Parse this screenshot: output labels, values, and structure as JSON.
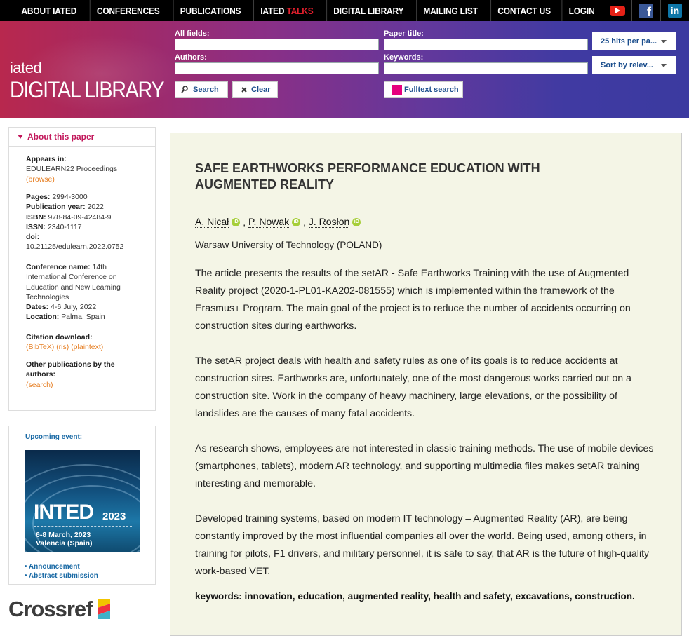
{
  "nav": {
    "items": [
      "ABOUT IATED",
      "CONFERENCES",
      "PUBLICATIONS",
      "IATED",
      "DIGITAL LIBRARY",
      "MAILING LIST",
      "CONTACT US",
      "LOGIN"
    ],
    "talks_suffix": "TALKS",
    "social_icons": [
      "youtube-icon",
      "facebook-icon",
      "linkedin-icon"
    ],
    "fb_glyph": "f",
    "li_glyph": "in"
  },
  "brand": {
    "small": "iated",
    "big": "DIGITAL LIBRARY"
  },
  "search": {
    "all_fields_label": "All fields:",
    "authors_label": "Authors:",
    "paper_title_label": "Paper title:",
    "keywords_label": "Keywords:",
    "all_fields_value": "",
    "authors_value": "",
    "paper_title_value": "",
    "keywords_value": "",
    "search_button": "Search",
    "clear_button": "Clear",
    "fulltext_button": "Fulltext search",
    "hits_select": "25 hits per pa...",
    "sort_select": "Sort by relev..."
  },
  "sidebar": {
    "about_title": "About this paper",
    "appears_in_label": "Appears in:",
    "appears_in_value": "EDULEARN22 Proceedings",
    "browse_link": "(browse)",
    "pages_label": "Pages:",
    "pages_value": "2994-3000",
    "pubyear_label": "Publication year:",
    "pubyear_value": "2022",
    "isbn_label": "ISBN:",
    "isbn_value": "978-84-09-42484-9",
    "issn_label": "ISSN:",
    "issn_value": "2340-1117",
    "doi_label": "doi:",
    "doi_value": "10.21125/edulearn.2022.0752",
    "conf_label": "Conference name:",
    "conf_value_1": "14th",
    "conf_value_2": "International Conference on",
    "conf_value_3": "Education and New Learning",
    "conf_value_4": "Technologies",
    "dates_label": "Dates:",
    "dates_value": "4-6 July, 2022",
    "location_label": "Location:",
    "location_value": "Palma, Spain",
    "citation_label": "Citation download:",
    "citation_links": [
      "(BibTeX)",
      "(ris)",
      "(plaintext)"
    ],
    "other_pubs_label_1": "Other publications by the",
    "other_pubs_label_2": "authors:",
    "search_link": "(search)"
  },
  "event": {
    "title": "Upcoming event:",
    "name": "INTED",
    "year": "2023",
    "dates": "6-8 March, 2023",
    "place": "Valencia (Spain)",
    "links": [
      "• Announcement",
      "• Abstract submission"
    ]
  },
  "crossref": {
    "word": "Crossref",
    "colors": [
      "#f2c500",
      "#ef3340",
      "#3eb1c8"
    ]
  },
  "paper": {
    "title": "SAFE EARTHWORKS PERFORMANCE EDUCATION WITH AUGMENTED REALITY",
    "authors": [
      "A. Nicał",
      "P. Nowak",
      "J. Rosłon"
    ],
    "orcid_label": "iD",
    "separator": ",",
    "affiliation": "Warsaw University of Technology (POLAND)",
    "abstract": [
      "The article presents the results of the setAR - Safe Earthworks Training with the use of Augmented Reality project (2020-1-PL01-KA202-081555) which is implemented within the framework of the Erasmus+ Program. The main goal of the project is to reduce the number of accidents occurring on construction sites during earthworks.",
      "The setAR project deals with health and safety rules as one of its goals is to reduce accidents at construction sites. Earthworks are, unfortunately, one of the most dangerous works carried out on a construction site. Work in the company of heavy machinery, large elevations, or the possibility of landslides are the causes of many fatal accidents.",
      "As research shows, employees are not interested in classic training methods. The use of mobile devices (smartphones, tablets), modern AR technology, and supporting multimedia files makes setAR training interesting and memorable.",
      "Developed training systems, based on modern IT technology – Augmented Reality (AR), are being constantly improved by the most influential companies all over the world. Being used, among others, in training for pilots, F1 drivers, and military personnel, it is safe to say, that AR is the future of high-quality work-based VET."
    ],
    "keywords_label": "keywords:",
    "keywords": [
      "innovation",
      "education",
      "augmented reality",
      "health and safety",
      "excavations",
      "construction"
    ]
  },
  "colors": {
    "accent_pink": "#c2185b",
    "link_orange": "#e67e22",
    "link_blue": "#1a6aa5",
    "paper_bg": "#f4f5e6"
  }
}
